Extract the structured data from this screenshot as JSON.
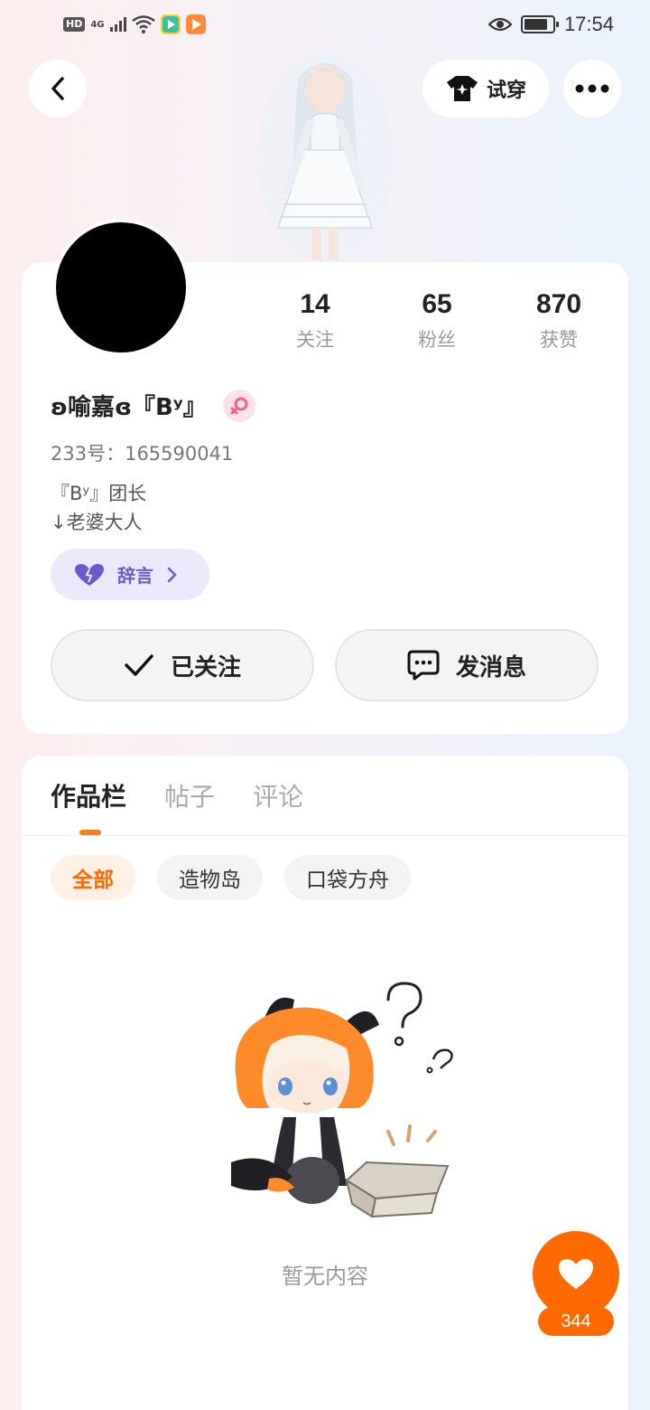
{
  "status_bar": {
    "network_badge": "HD",
    "network_type": "4G",
    "time": "17:54",
    "battery_level": 0.85,
    "icons": [
      "hd-icon",
      "signal-icon",
      "wifi-icon",
      "app-icon",
      "app-icon",
      "eye-icon",
      "battery-icon"
    ]
  },
  "header": {
    "try_on_label": "试穿"
  },
  "profile": {
    "stats": [
      {
        "value": "14",
        "label": "关注"
      },
      {
        "value": "65",
        "label": "粉丝"
      },
      {
        "value": "870",
        "label": "获赞"
      }
    ],
    "name": "ʚ喻嘉ɞ『Bʸ』",
    "uid": "233号：165590041",
    "bio_lines": [
      "『Bʸ』团长",
      "↓老婆大人"
    ],
    "farewell_label": "辞言",
    "follow_label": "已关注",
    "message_label": "发消息"
  },
  "works": {
    "tabs": [
      "作品栏",
      "帖子",
      "评论"
    ],
    "chips": [
      "全部",
      "造物岛",
      "口袋方舟"
    ],
    "empty_text": "暂无内容"
  },
  "like": {
    "count": "344"
  },
  "colors": {
    "accent": "#ff6a00",
    "farewell_bg": "#ebe8fb",
    "farewell_text": "#6a5acd",
    "gender_pink": "#f06292"
  }
}
